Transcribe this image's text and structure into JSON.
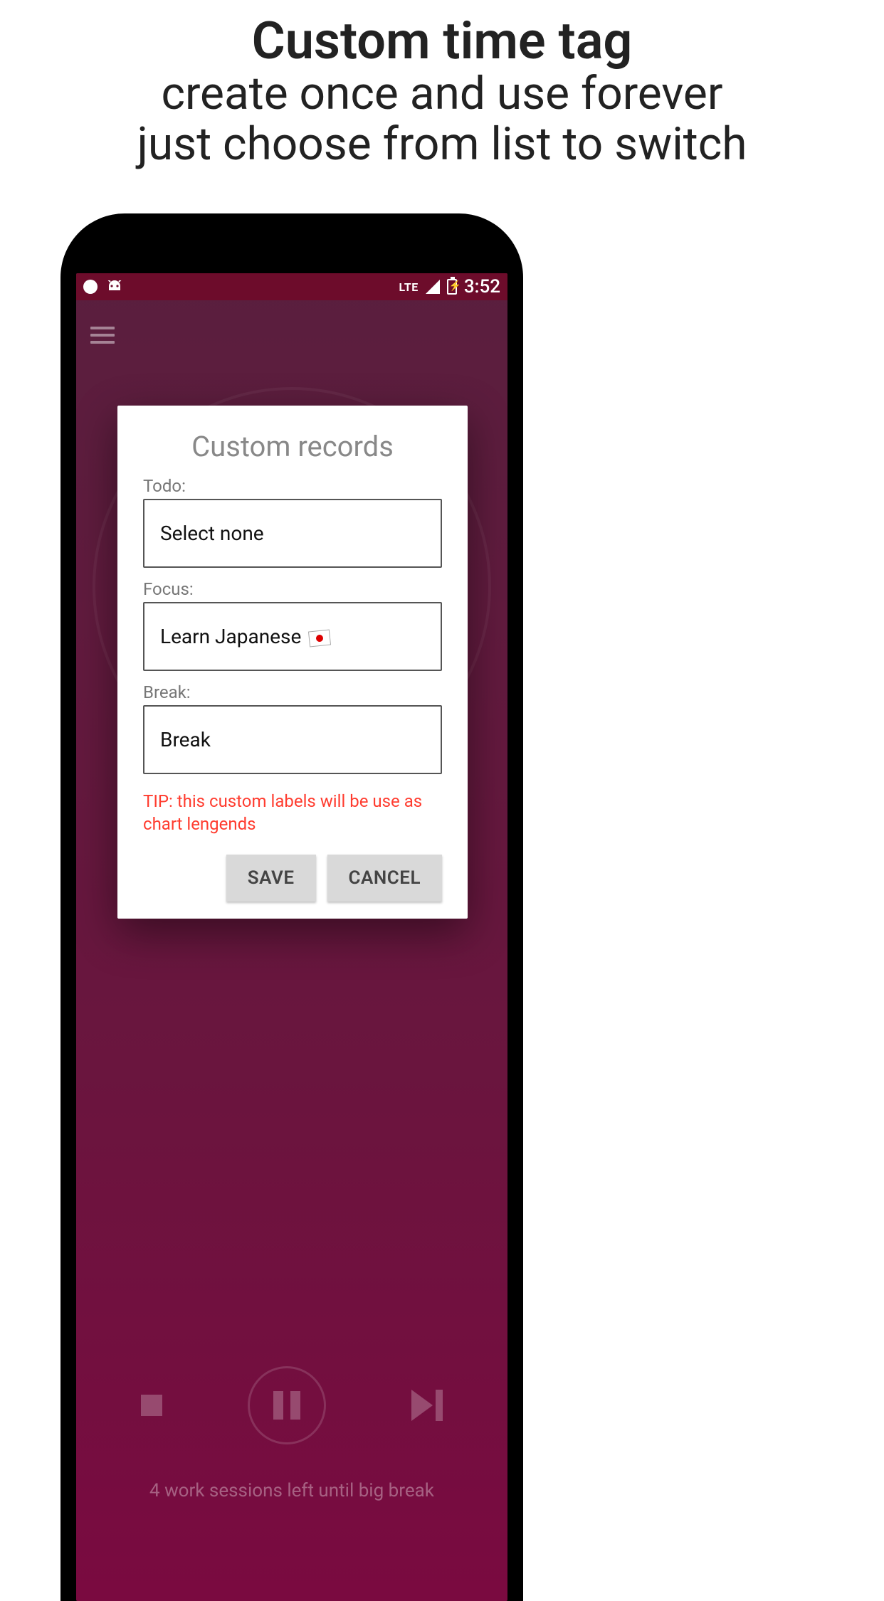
{
  "promo": {
    "title": "Custom time tag",
    "line1": "create once and use forever",
    "line2": "just choose from list to switch"
  },
  "statusbar": {
    "lte": "LTE",
    "time": "3:52"
  },
  "dialog": {
    "title": "Custom records",
    "todo_label": "Todo:",
    "todo_value": "Select none",
    "focus_label": "Focus:",
    "focus_value": "Learn Japanese",
    "break_label": "Break:",
    "break_value": "Break",
    "tip": "TIP: this custom labels will be use as chart lengends",
    "save": "SAVE",
    "cancel": "CANCEL"
  },
  "footer": {
    "sessions": "4 work sessions left until big break"
  }
}
